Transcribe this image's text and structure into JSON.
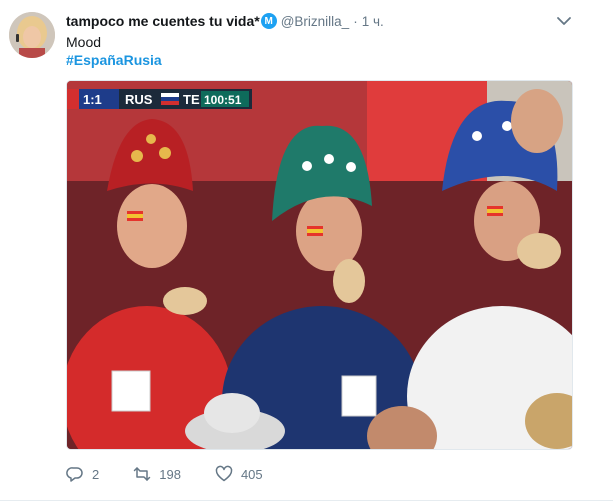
{
  "tweet": {
    "display_name": "tampoco me cuentes tu vida*",
    "verified_badge": "M",
    "handle": "@Briznilla_",
    "separator": "·",
    "time": "1 ч.",
    "text": "Mood",
    "hashtag": "#EspañaRusia",
    "scoreboard": {
      "home_score": "1:1",
      "home": "RUS",
      "away": "TE",
      "clock": "100:51"
    },
    "actions": {
      "replies": "2",
      "retweets": "198",
      "likes": "405"
    },
    "icons": {
      "more": "chevron-down-icon",
      "reply": "reply-icon",
      "retweet": "retweet-icon",
      "like": "heart-icon"
    },
    "colors": {
      "link": "#1b95e0",
      "muted": "#657786",
      "verified": "#1da1f2"
    }
  }
}
